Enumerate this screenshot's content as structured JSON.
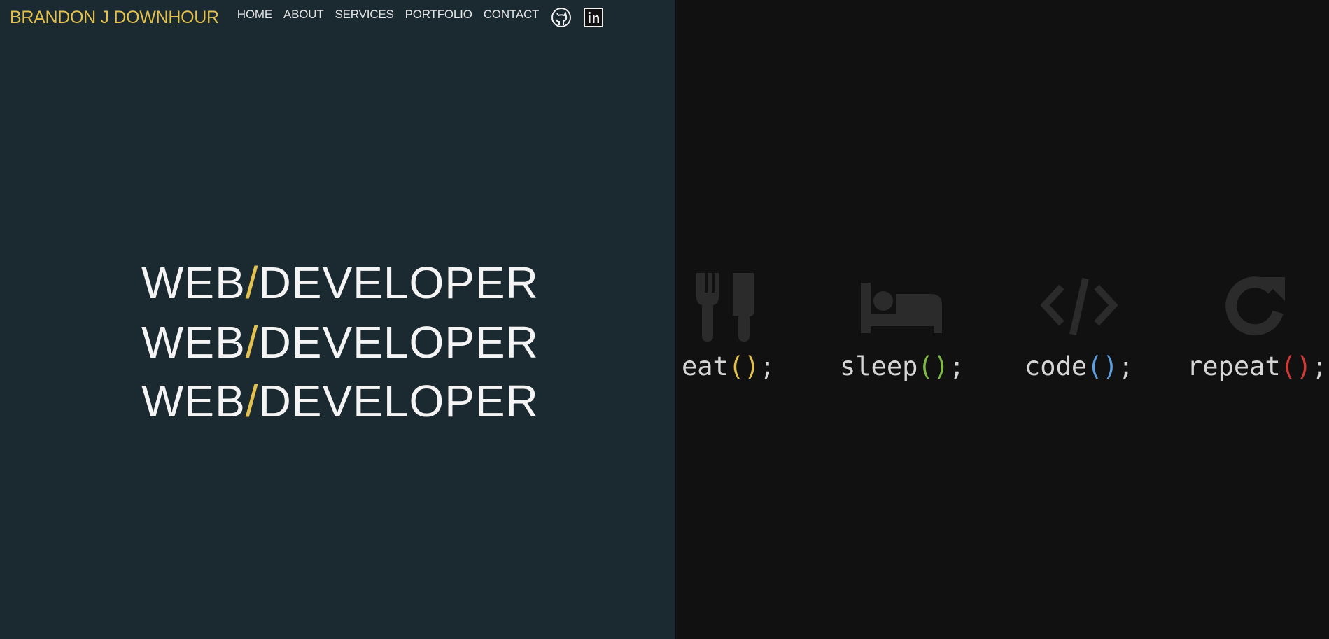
{
  "nav": {
    "brand": "BRANDON J DOWNHOUR",
    "links": [
      "HOME",
      "ABOUT",
      "SERVICES",
      "PORTFOLIO",
      "CONTACT"
    ],
    "social_icons": [
      "github-icon",
      "linkedin-icon"
    ]
  },
  "hero": {
    "lines": [
      {
        "left": "WEB",
        "slash": "/",
        "right": "DEVELOPER"
      },
      {
        "left": "WEB",
        "slash": "/",
        "right": "DEVELOPER"
      },
      {
        "left": "WEB",
        "slash": "/",
        "right": "DEVELOPER"
      }
    ]
  },
  "routine": [
    {
      "icon": "fork-knife-icon",
      "name": "eat",
      "open": "(",
      "close": ")",
      "semi": ";",
      "paren_color": "#e3c14e"
    },
    {
      "icon": "bed-icon",
      "name": "sleep",
      "open": "(",
      "close": ")",
      "semi": ";",
      "paren_color": "#7dbb41"
    },
    {
      "icon": "code-icon",
      "name": "code",
      "open": "(",
      "close": ")",
      "semi": ";",
      "paren_color": "#5d9fe0"
    },
    {
      "icon": "repeat-icon",
      "name": "repeat",
      "open": "(",
      "close": ")",
      "semi": ";",
      "paren_color": "#d13a34"
    }
  ],
  "colors": {
    "left_panel": "#1b2930",
    "right_panel": "#111111",
    "accent": "#e3c14e",
    "icon_gray": "#2b2b2b"
  }
}
